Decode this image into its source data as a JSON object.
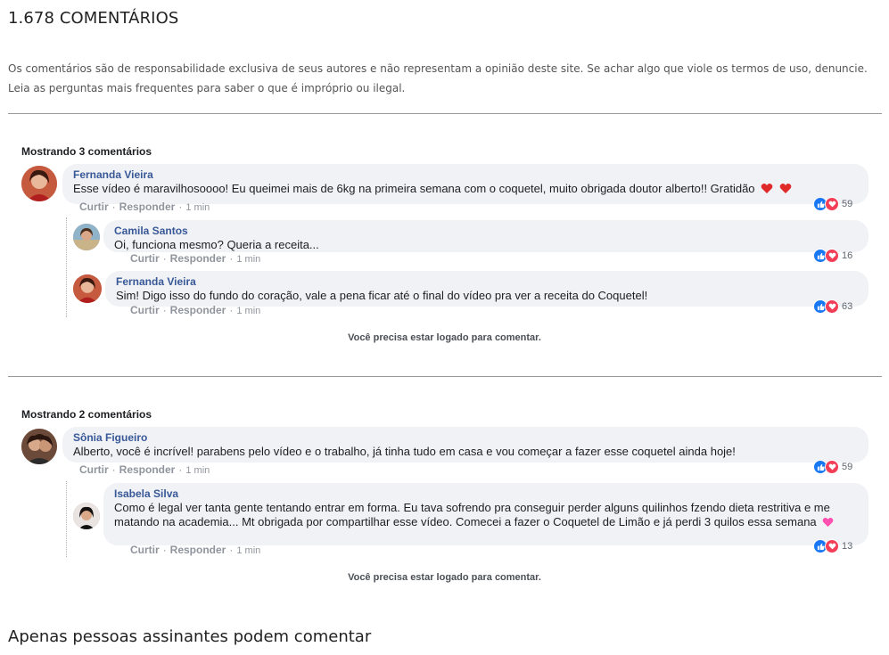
{
  "header": {
    "title": "1.678 COMENTÁRIOS",
    "disclaimer": "Os comentários são de responsabilidade exclusiva de seus autores e não representam a opinião deste site. Se achar algo que viole os termos de uso, denuncie. Leia as perguntas mais frequentes para saber o que é impróprio ou ilegal."
  },
  "actions": {
    "like": "Curtir",
    "reply": "Responder"
  },
  "login_required": "Você precisa estar logado para comentar.",
  "thread1": {
    "showing": "Mostrando 3 comentários",
    "main": {
      "author": "Fernanda Vieira",
      "text": "Esse vídeo é maravilhosoooo! Eu queimei mais de 6kg na primeira semana com o coquetel, muito obrigada doutor alberto!! Gratidão",
      "emoji": "heart-icon x2",
      "time": "1 min",
      "reactions": "59"
    },
    "replies": [
      {
        "author": "Camila Santos",
        "text": "Oi, funciona mesmo? Queria a receita...",
        "time": "1 min",
        "reactions": "16"
      },
      {
        "author": "Fernanda Vieira",
        "text": "Sim! Digo isso do fundo do coração, vale a pena ficar até o final do vídeo pra ver a receita do Coquetel!",
        "time": "1 min",
        "reactions": "63"
      }
    ]
  },
  "thread2": {
    "showing": "Mostrando 2 comentários",
    "main": {
      "author": "Sônia Figueiro",
      "text": "Alberto, você é incrível! parabens pelo vídeo e o trabalho, já tinha tudo em casa e vou começar a fazer esse coquetel ainda hoje!",
      "time": "1 min",
      "reactions": "59"
    },
    "replies": [
      {
        "author": "Isabela Silva",
        "text": "Como é legal ver tanta gente tentando entrar em forma. Eu tava sofrendo pra conseguir perder alguns quilinhos fzendo dieta restritiva e me matando na academia... Mt obrigada por compartilhar esse vídeo. Comecei a fazer o Coquetel de Limão e já perdi 3 quilos essa semana",
        "emoji": "pink-heart-icon",
        "time": "1 min",
        "reactions": "13"
      }
    ]
  },
  "footer": {
    "title": "Apenas pessoas assinantes podem comentar"
  },
  "colors": {
    "author": "#385898",
    "bubble": "#f0f2f5",
    "like": "#1877f2",
    "love": "#f33e58"
  }
}
